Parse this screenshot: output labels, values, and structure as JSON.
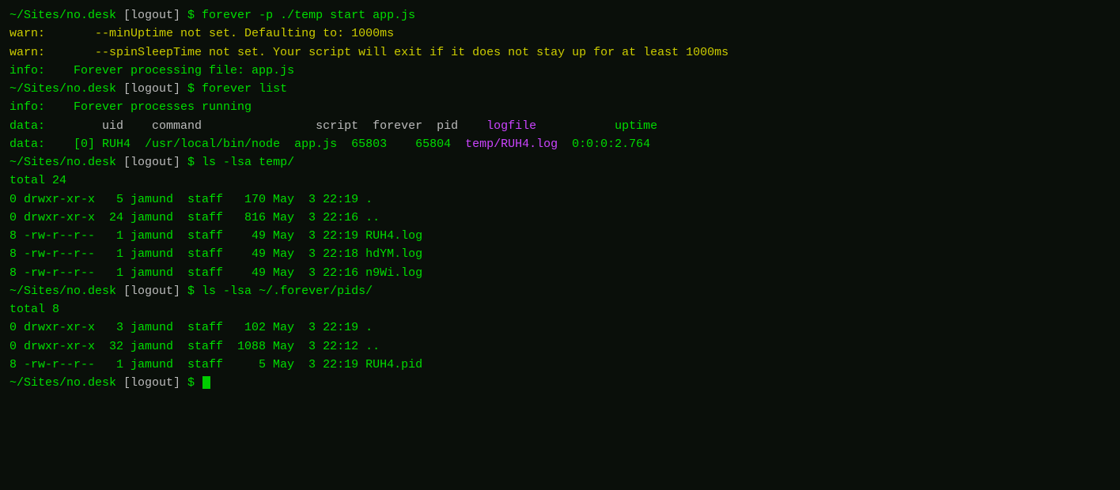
{
  "terminal": {
    "lines": [
      {
        "id": "line1",
        "parts": [
          {
            "text": "~/Sites/no.desk ",
            "color": "green"
          },
          {
            "text": "[logout]",
            "color": "white"
          },
          {
            "text": " $ forever -p ./temp start app.js",
            "color": "green"
          }
        ]
      },
      {
        "id": "line2",
        "parts": [
          {
            "text": "warn:",
            "color": "yellow"
          },
          {
            "text": "\t    --minUptime not set. Defaulting to: 1000ms",
            "color": "yellow"
          }
        ]
      },
      {
        "id": "line3",
        "parts": [
          {
            "text": "warn:",
            "color": "yellow"
          },
          {
            "text": "\t    --spinSleepTime not set. Your script will exit if it does not stay up for at least 1000ms",
            "color": "yellow"
          }
        ]
      },
      {
        "id": "line4",
        "parts": [
          {
            "text": "info:",
            "color": "green"
          },
          {
            "text": "    Forever processing file: app.js",
            "color": "green"
          }
        ]
      },
      {
        "id": "line5",
        "parts": [
          {
            "text": "~/Sites/no.desk ",
            "color": "green"
          },
          {
            "text": "[logout]",
            "color": "white"
          },
          {
            "text": " $ forever list",
            "color": "green"
          }
        ]
      },
      {
        "id": "line6",
        "parts": [
          {
            "text": "info:",
            "color": "green"
          },
          {
            "text": "    Forever processes running",
            "color": "green"
          }
        ]
      },
      {
        "id": "line7",
        "parts": [
          {
            "text": "data:",
            "color": "green"
          },
          {
            "text": "        uid    command                script  forever  pid    ",
            "color": "white"
          },
          {
            "text": "logfile",
            "color": "magenta"
          },
          {
            "text": "           ",
            "color": "white"
          },
          {
            "text": "uptime",
            "color": "green"
          }
        ]
      },
      {
        "id": "line8",
        "parts": [
          {
            "text": "data:",
            "color": "green"
          },
          {
            "text": "    [0] RUH4  /usr/local/bin/node  app.js  65803    65804  ",
            "color": "green"
          },
          {
            "text": "temp/RUH4.log",
            "color": "magenta"
          },
          {
            "text": "  0:0:0:2.764",
            "color": "green"
          }
        ]
      },
      {
        "id": "line9",
        "parts": [
          {
            "text": "~/Sites/no.desk ",
            "color": "green"
          },
          {
            "text": "[logout]",
            "color": "white"
          },
          {
            "text": " $ ls -lsa temp/",
            "color": "green"
          }
        ]
      },
      {
        "id": "line10",
        "parts": [
          {
            "text": "total 24",
            "color": "green"
          }
        ]
      },
      {
        "id": "line11",
        "parts": [
          {
            "text": "0 drwxr-xr-x   5 jamund  staff   170 May  3 22:19 .",
            "color": "green"
          }
        ]
      },
      {
        "id": "line12",
        "parts": [
          {
            "text": "0 drwxr-xr-x  24 jamund  staff   816 May  3 22:16 ..",
            "color": "green"
          }
        ]
      },
      {
        "id": "line13",
        "parts": [
          {
            "text": "8 -rw-r--r--   1 jamund  staff    49 May  3 22:19 RUH4.log",
            "color": "green"
          }
        ]
      },
      {
        "id": "line14",
        "parts": [
          {
            "text": "8 -rw-r--r--   1 jamund  staff    49 May  3 22:18 hdYM.log",
            "color": "green"
          }
        ]
      },
      {
        "id": "line15",
        "parts": [
          {
            "text": "8 -rw-r--r--   1 jamund  staff    49 May  3 22:16 n9Wi.log",
            "color": "green"
          }
        ]
      },
      {
        "id": "line16",
        "parts": [
          {
            "text": "~/Sites/no.desk ",
            "color": "green"
          },
          {
            "text": "[logout]",
            "color": "white"
          },
          {
            "text": " $ ls -lsa ~/.forever/pids/",
            "color": "green"
          }
        ]
      },
      {
        "id": "line17",
        "parts": [
          {
            "text": "total 8",
            "color": "green"
          }
        ]
      },
      {
        "id": "line18",
        "parts": [
          {
            "text": "0 drwxr-xr-x   3 jamund  staff   102 May  3 22:19 .",
            "color": "green"
          }
        ]
      },
      {
        "id": "line19",
        "parts": [
          {
            "text": "0 drwxr-xr-x  32 jamund  staff  1088 May  3 22:12 ..",
            "color": "green"
          }
        ]
      },
      {
        "id": "line20",
        "parts": [
          {
            "text": "8 -rw-r--r--   1 jamund  staff     5 May  3 22:19 RUH4.pid",
            "color": "green"
          }
        ]
      },
      {
        "id": "line21",
        "parts": [
          {
            "text": "~/Sites/no.desk ",
            "color": "green"
          },
          {
            "text": "[logout]",
            "color": "white"
          },
          {
            "text": " $ ",
            "color": "green"
          }
        ],
        "cursor": true
      }
    ]
  }
}
